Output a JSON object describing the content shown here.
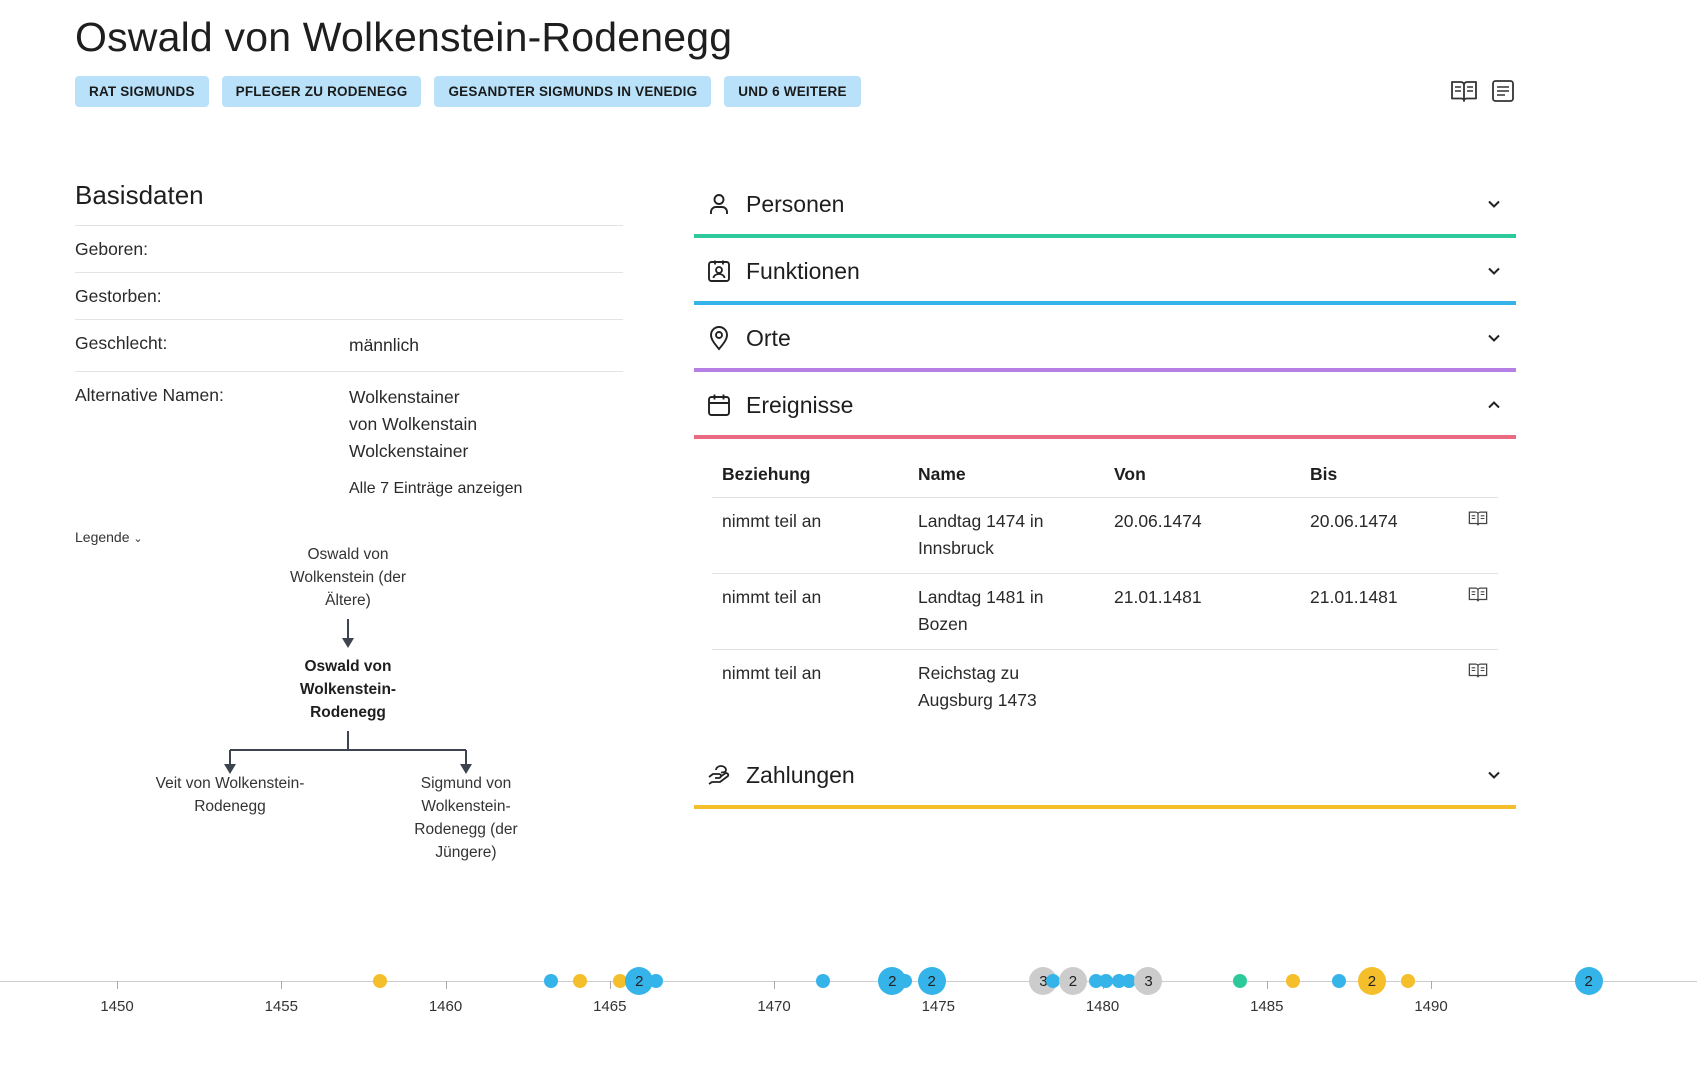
{
  "header": {
    "title": "Oswald von Wolkenstein-Rodenegg",
    "tags": [
      "RAT SIGMUNDS",
      "PFLEGER ZU RODENEGG",
      "GESANDTER SIGMUNDS IN VENEDIG",
      "UND 6 WEITERE"
    ],
    "icons": [
      "book-icon",
      "list-icon"
    ]
  },
  "basis": {
    "heading": "Basisdaten",
    "rows": [
      {
        "key": "Geboren:",
        "value": ""
      },
      {
        "key": "Gestorben:",
        "value": ""
      },
      {
        "key": "Geschlecht:",
        "value": "männlich"
      },
      {
        "key": "Alternative Namen:",
        "values": [
          "Wolkenstainer",
          "von Wolkenstain",
          "Wolckenstainer"
        ]
      }
    ],
    "more_link": "Alle 7 Einträge anzeigen"
  },
  "tree": {
    "legend": "Legende",
    "parent": "Oswald von Wolkenstein (der Ältere)",
    "self": "Oswald von Wolkenstein-Rodenegg",
    "child1": "Veit von Wolkenstein-Rodenegg",
    "child2": "Sigmund von Wolkenstein-Rodenegg (der Jüngere)"
  },
  "accordion": {
    "sections": [
      {
        "label": "Personen",
        "icon": "person-icon",
        "color": "#2ec99a",
        "expanded": false
      },
      {
        "label": "Funktionen",
        "icon": "id-badge-icon",
        "color": "#35b4ea",
        "expanded": false
      },
      {
        "label": "Orte",
        "icon": "map-pin-icon",
        "color": "#b67fe3",
        "expanded": false
      },
      {
        "label": "Ereignisse",
        "icon": "calendar-icon",
        "color": "#ea6a82",
        "expanded": true
      },
      {
        "label": "Zahlungen",
        "icon": "payment-icon",
        "color": "#f5be2b",
        "expanded": false
      }
    ]
  },
  "events": {
    "columns": [
      "Beziehung",
      "Name",
      "Von",
      "Bis"
    ],
    "rows": [
      {
        "relation": "nimmt teil an",
        "name": "Landtag 1474 in Innsbruck",
        "from": "20.06.1474",
        "to": "20.06.1474"
      },
      {
        "relation": "nimmt teil an",
        "name": "Landtag 1481 in Bozen",
        "from": "21.01.1481",
        "to": "21.01.1481"
      },
      {
        "relation": "nimmt teil an",
        "name": "Reichstag zu Augsburg 1473",
        "from": "",
        "to": ""
      }
    ]
  },
  "timeline": {
    "ticks": [
      "1450",
      "1455",
      "1460",
      "1465",
      "1470",
      "1475",
      "1480",
      "1485",
      "1490"
    ],
    "markers": [
      {
        "year": 1458.0,
        "color": "#f5be2b",
        "count": ""
      },
      {
        "year": 1463.2,
        "color": "#35b4ea",
        "count": ""
      },
      {
        "year": 1464.1,
        "color": "#f5be2b",
        "count": ""
      },
      {
        "year": 1465.3,
        "color": "#f5be2b",
        "count": ""
      },
      {
        "year": 1465.9,
        "color": "#35b4ea",
        "count": "2"
      },
      {
        "year": 1466.4,
        "color": "#35b4ea",
        "count": ""
      },
      {
        "year": 1471.5,
        "color": "#35b4ea",
        "count": ""
      },
      {
        "year": 1473.6,
        "color": "#35b4ea",
        "count": "2"
      },
      {
        "year": 1474.0,
        "color": "#35b4ea",
        "count": ""
      },
      {
        "year": 1474.8,
        "color": "#35b4ea",
        "count": "2"
      },
      {
        "year": 1478.2,
        "color": "#cccccc",
        "count": "3"
      },
      {
        "year": 1478.5,
        "color": "#35b4ea",
        "count": ""
      },
      {
        "year": 1479.1,
        "color": "#cccccc",
        "count": "2"
      },
      {
        "year": 1479.8,
        "color": "#35b4ea",
        "count": ""
      },
      {
        "year": 1480.1,
        "color": "#35b4ea",
        "count": ""
      },
      {
        "year": 1480.5,
        "color": "#35b4ea",
        "count": ""
      },
      {
        "year": 1480.8,
        "color": "#35b4ea",
        "count": ""
      },
      {
        "year": 1481.4,
        "color": "#cccccc",
        "count": "3"
      },
      {
        "year": 1484.2,
        "color": "#2ec99a",
        "count": ""
      },
      {
        "year": 1485.8,
        "color": "#f5be2b",
        "count": ""
      },
      {
        "year": 1487.2,
        "color": "#35b4ea",
        "count": ""
      },
      {
        "year": 1488.2,
        "color": "#f5be2b",
        "count": "2"
      },
      {
        "year": 1489.3,
        "color": "#f5be2b",
        "count": ""
      },
      {
        "year": 1494.8,
        "color": "#35b4ea",
        "count": "2"
      }
    ]
  }
}
